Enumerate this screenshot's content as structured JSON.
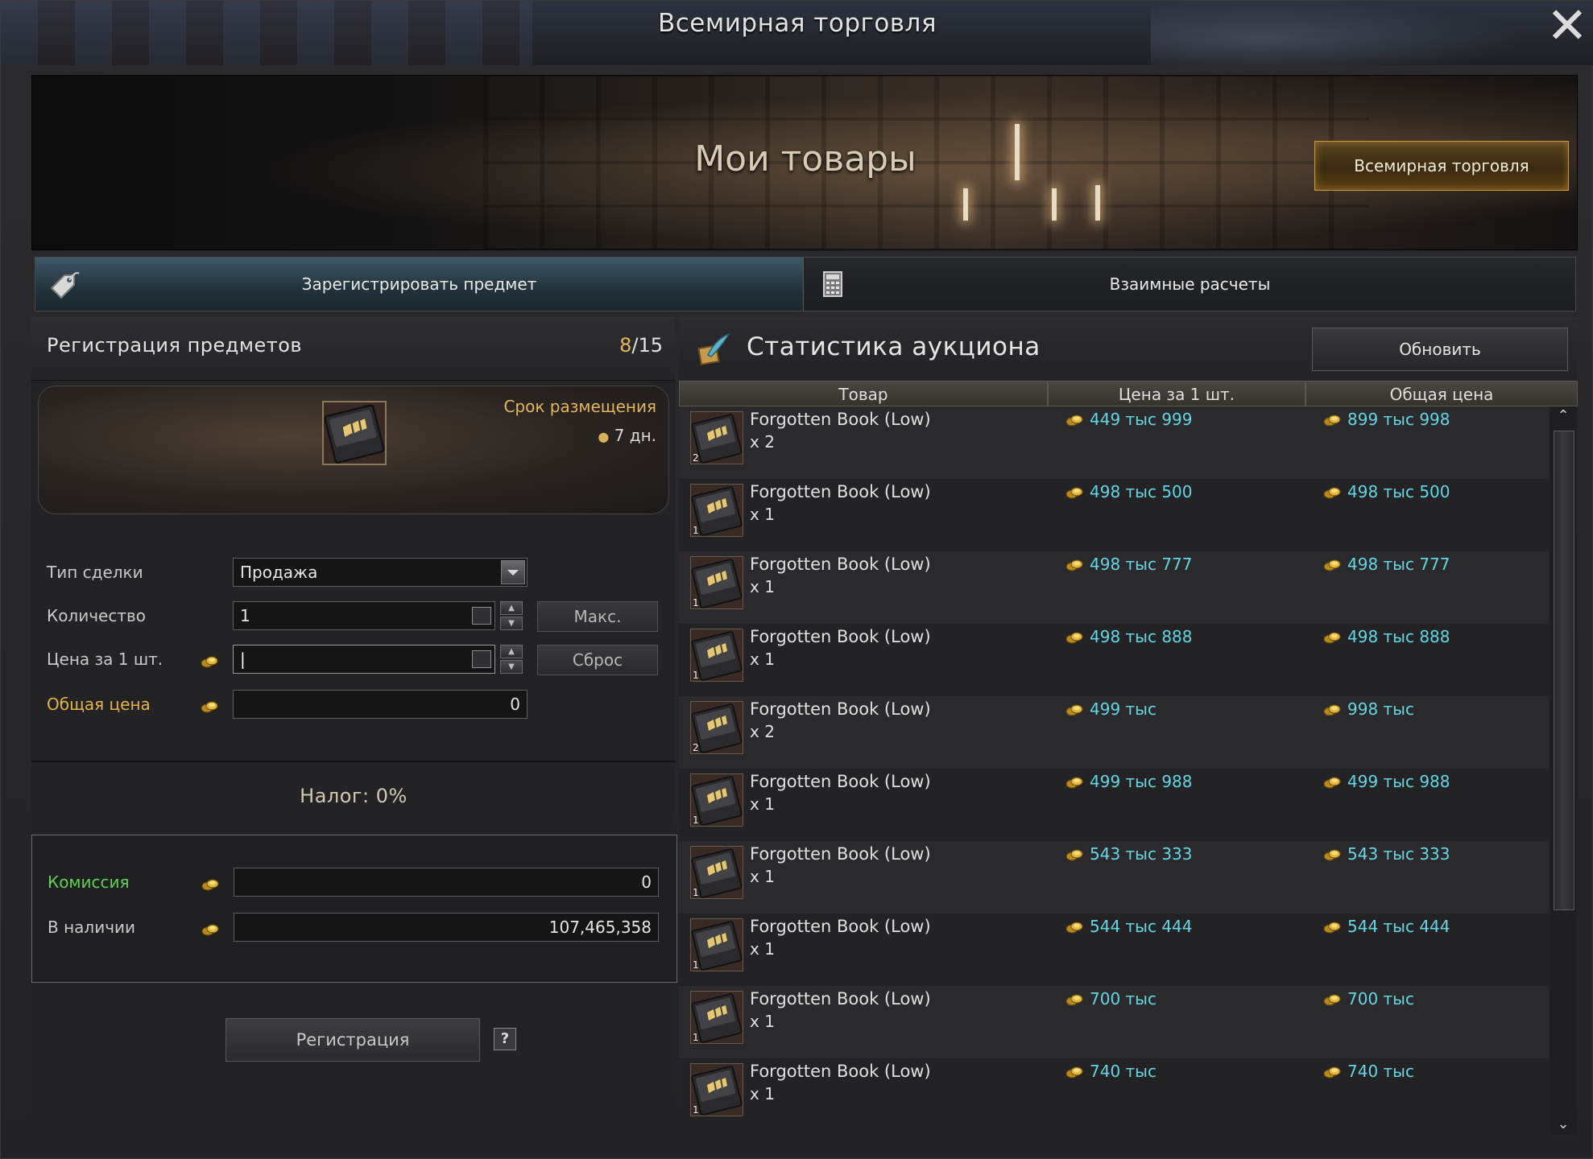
{
  "window": {
    "title": "Всемирная торговля",
    "close_label": "✕"
  },
  "banner": {
    "title": "Мои товары",
    "world_trade_button": "Всемирная торговля"
  },
  "tabs": [
    {
      "label": "Зарегистрировать предмет",
      "active": true,
      "icon": "price-tag-icon"
    },
    {
      "label": "Взаимные расчеты",
      "active": false,
      "icon": "calculator-icon"
    }
  ],
  "registration": {
    "title": "Регистрация предметов",
    "count_current": "8",
    "count_total": "/15",
    "period_label": "Срок размещения",
    "period_value": "7 дн.",
    "deal_type_label": "Тип сделки",
    "deal_type_value": "Продажа",
    "quantity_label": "Количество",
    "quantity_value": "1",
    "max_button": "Макс.",
    "unit_price_label": "Цена за 1 шт.",
    "unit_price_value": "",
    "reset_button": "Сброс",
    "total_price_label": "Общая цена",
    "total_price_value": "0",
    "tax_text": "Налог: 0%",
    "commission_label": "Комиссия",
    "commission_value": "0",
    "available_label": "В наличии",
    "available_value": "107,465,358",
    "register_button": "Регистрация",
    "help_label": "?"
  },
  "stats": {
    "title": "Статистика аукциона",
    "refresh_button": "Обновить",
    "columns": [
      "Товар",
      "Цена за 1 шт.",
      "Общая цена"
    ],
    "rows": [
      {
        "badge": "2",
        "name": "Forgotten Book (Low)",
        "qty": "x 2",
        "unit_price": "449 тыс 999",
        "total_price": "899 тыс 998"
      },
      {
        "badge": "1",
        "name": "Forgotten Book (Low)",
        "qty": "x 1",
        "unit_price": "498 тыс 500",
        "total_price": "498 тыс 500"
      },
      {
        "badge": "1",
        "name": "Forgotten Book (Low)",
        "qty": "x 1",
        "unit_price": "498 тыс 777",
        "total_price": "498 тыс 777"
      },
      {
        "badge": "1",
        "name": "Forgotten Book (Low)",
        "qty": "x 1",
        "unit_price": "498 тыс 888",
        "total_price": "498 тыс 888"
      },
      {
        "badge": "2",
        "name": "Forgotten Book (Low)",
        "qty": "x 2",
        "unit_price": "499 тыс",
        "total_price": "998 тыс"
      },
      {
        "badge": "1",
        "name": "Forgotten Book (Low)",
        "qty": "x 1",
        "unit_price": "499 тыс 988",
        "total_price": "499 тыс 988"
      },
      {
        "badge": "1",
        "name": "Forgotten Book (Low)",
        "qty": "x 1",
        "unit_price": "543 тыс 333",
        "total_price": "543 тыс 333"
      },
      {
        "badge": "1",
        "name": "Forgotten Book (Low)",
        "qty": "x 1",
        "unit_price": "544 тыс 444",
        "total_price": "544 тыс 444"
      },
      {
        "badge": "1",
        "name": "Forgotten Book (Low)",
        "qty": "x 1",
        "unit_price": "700 тыс",
        "total_price": "700 тыс"
      },
      {
        "badge": "1",
        "name": "Forgotten Book (Low)",
        "qty": "x 1",
        "unit_price": "740 тыс",
        "total_price": "740 тыс"
      }
    ]
  },
  "colors": {
    "price": "#63d5e3",
    "gold_label": "#e4b34a",
    "commission_label": "#5fd255",
    "accent_button_border": "#c99a3a"
  }
}
